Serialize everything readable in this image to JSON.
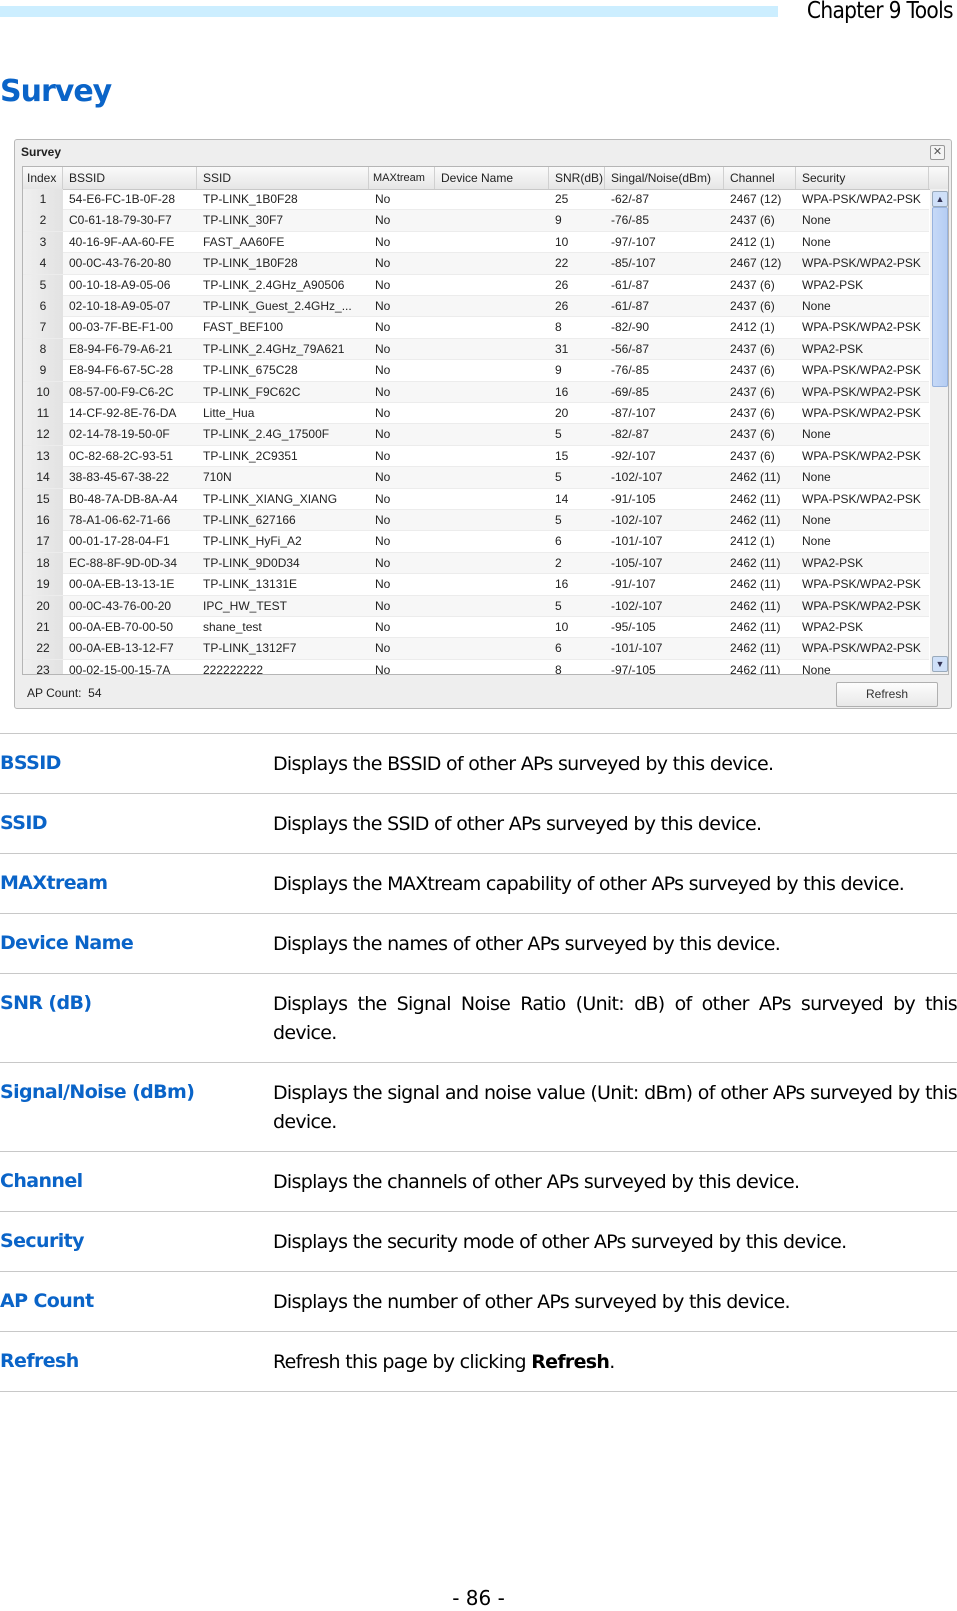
{
  "header": {
    "chapter": "Chapter 9 Tools"
  },
  "section_title": "Survey",
  "panel": {
    "title": "Survey",
    "close_icon": "close-icon",
    "columns": [
      "Index",
      "BSSID",
      "SSID",
      "MAXtream",
      "Device Name",
      "SNR(dB)",
      "Singal/Noise(dBm)",
      "Channel",
      "Security"
    ],
    "rows": [
      [
        "1",
        "54-E6-FC-1B-0F-28",
        "TP-LINK_1B0F28",
        "No",
        "",
        "25",
        "-62/-87",
        "2467 (12)",
        "WPA-PSK/WPA2-PSK"
      ],
      [
        "2",
        "C0-61-18-79-30-F7",
        "TP-LINK_30F7",
        "No",
        "",
        "9",
        "-76/-85",
        "2437 (6)",
        "None"
      ],
      [
        "3",
        "40-16-9F-AA-60-FE",
        "FAST_AA60FE",
        "No",
        "",
        "10",
        "-97/-107",
        "2412 (1)",
        "None"
      ],
      [
        "4",
        "00-0C-43-76-20-80",
        "TP-LINK_1B0F28",
        "No",
        "",
        "22",
        "-85/-107",
        "2467 (12)",
        "WPA-PSK/WPA2-PSK"
      ],
      [
        "5",
        "00-10-18-A9-05-06",
        "TP-LINK_2.4GHz_A90506",
        "No",
        "",
        "26",
        "-61/-87",
        "2437 (6)",
        "WPA2-PSK"
      ],
      [
        "6",
        "02-10-18-A9-05-07",
        "TP-LINK_Guest_2.4GHz_...",
        "No",
        "",
        "26",
        "-61/-87",
        "2437 (6)",
        "None"
      ],
      [
        "7",
        "00-03-7F-BE-F1-00",
        "FAST_BEF100",
        "No",
        "",
        "8",
        "-82/-90",
        "2412 (1)",
        "WPA-PSK/WPA2-PSK"
      ],
      [
        "8",
        "E8-94-F6-79-A6-21",
        "TP-LINK_2.4GHz_79A621",
        "No",
        "",
        "31",
        "-56/-87",
        "2437 (6)",
        "WPA2-PSK"
      ],
      [
        "9",
        "E8-94-F6-67-5C-28",
        "TP-LINK_675C28",
        "No",
        "",
        "9",
        "-76/-85",
        "2437 (6)",
        "WPA-PSK/WPA2-PSK"
      ],
      [
        "10",
        "08-57-00-F9-C6-2C",
        "TP-LINK_F9C62C",
        "No",
        "",
        "16",
        "-69/-85",
        "2437 (6)",
        "WPA-PSK/WPA2-PSK"
      ],
      [
        "11",
        "14-CF-92-8E-76-DA",
        "Litte_Hua",
        "No",
        "",
        "20",
        "-87/-107",
        "2437 (6)",
        "WPA-PSK/WPA2-PSK"
      ],
      [
        "12",
        "02-14-78-19-50-0F",
        "TP-LINK_2.4G_17500F",
        "No",
        "",
        "5",
        "-82/-87",
        "2437 (6)",
        "None"
      ],
      [
        "13",
        "0C-82-68-2C-93-51",
        "TP-LINK_2C9351",
        "No",
        "",
        "15",
        "-92/-107",
        "2437 (6)",
        "WPA-PSK/WPA2-PSK"
      ],
      [
        "14",
        "38-83-45-67-38-22",
        "710N",
        "No",
        "",
        "5",
        "-102/-107",
        "2462 (11)",
        "None"
      ],
      [
        "15",
        "B0-48-7A-DB-8A-A4",
        "TP-LINK_XIANG_XIANG",
        "No",
        "",
        "14",
        "-91/-105",
        "2462 (11)",
        "WPA-PSK/WPA2-PSK"
      ],
      [
        "16",
        "78-A1-06-62-71-66",
        "TP-LINK_627166",
        "No",
        "",
        "5",
        "-102/-107",
        "2462 (11)",
        "None"
      ],
      [
        "17",
        "00-01-17-28-04-F1",
        "TP-LINK_HyFi_A2",
        "No",
        "",
        "6",
        "-101/-107",
        "2412 (1)",
        "None"
      ],
      [
        "18",
        "EC-88-8F-9D-0D-34",
        "TP-LINK_9D0D34",
        "No",
        "",
        "2",
        "-105/-107",
        "2462 (11)",
        "WPA2-PSK"
      ],
      [
        "19",
        "00-0A-EB-13-13-1E",
        "TP-LINK_13131E",
        "No",
        "",
        "16",
        "-91/-107",
        "2462 (11)",
        "WPA-PSK/WPA2-PSK"
      ],
      [
        "20",
        "00-0C-43-76-00-20",
        "IPC_HW_TEST",
        "No",
        "",
        "5",
        "-102/-107",
        "2462 (11)",
        "WPA-PSK/WPA2-PSK"
      ],
      [
        "21",
        "00-0A-EB-70-00-50",
        "shane_test",
        "No",
        "",
        "10",
        "-95/-105",
        "2462 (11)",
        "WPA2-PSK"
      ],
      [
        "22",
        "00-0A-EB-13-12-F7",
        "TP-LINK_1312F7",
        "No",
        "",
        "6",
        "-101/-107",
        "2462 (11)",
        "WPA-PSK/WPA2-PSK"
      ],
      [
        "23",
        "00-02-15-00-15-7A",
        "222222222",
        "No",
        "",
        "8",
        "-97/-105",
        "2462 (11)",
        "None"
      ]
    ],
    "ap_count_label": "AP Count:",
    "ap_count": "54",
    "refresh_label": "Refresh"
  },
  "definitions": [
    {
      "term": "BSSID",
      "desc": "Displays the BSSID of other APs surveyed by this device."
    },
    {
      "term": "SSID",
      "desc": "Displays the SSID of other APs surveyed by this device."
    },
    {
      "term": "MAXtream",
      "desc": "Displays the MAXtream capability of other APs surveyed by this device."
    },
    {
      "term": "Device Name",
      "desc": "Displays the names of other APs surveyed by this device."
    },
    {
      "term": "SNR (dB)",
      "desc": "Displays the Signal Noise Ratio (Unit: dB) of other APs surveyed by this device."
    },
    {
      "term": "Signal/Noise (dBm)",
      "desc": "Displays the signal and noise value (Unit: dBm) of other APs surveyed by this device."
    },
    {
      "term": "Channel",
      "desc": "Displays the channels of other APs surveyed by this device."
    },
    {
      "term": "Security",
      "desc": "Displays the security mode of other APs surveyed by this device."
    },
    {
      "term": "AP Count",
      "desc": "Displays the number of other APs surveyed by this device."
    },
    {
      "term": "Refresh",
      "desc": "Refresh this page by clicking ",
      "desc_bold": "Refresh",
      "desc_after": "."
    }
  ],
  "page_number": "- 86 -",
  "colors": {
    "accent": "#0a64c8",
    "header_bar": "#cceeff"
  }
}
